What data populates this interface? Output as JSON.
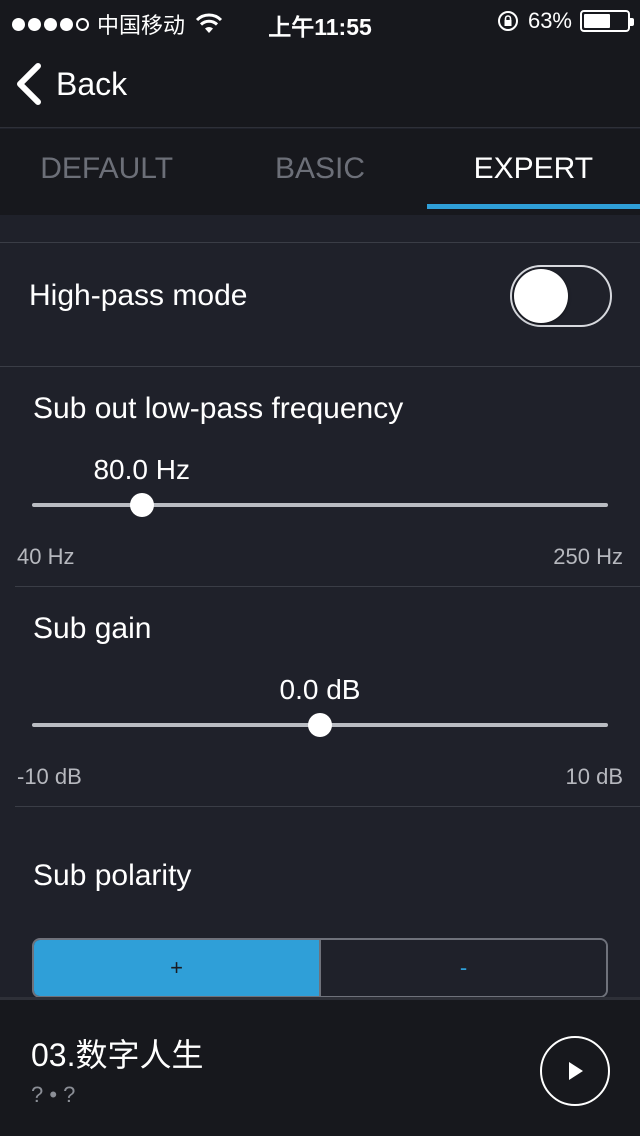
{
  "status_bar": {
    "carrier": "中国移动",
    "time": "上午11:55",
    "battery_percent_label": "63%",
    "battery_level": 0.63,
    "signal_dots_filled": 4,
    "signal_dots_total": 5
  },
  "nav": {
    "back_label": "Back"
  },
  "tabs": [
    {
      "label": "DEFAULT",
      "active": false
    },
    {
      "label": "BASIC",
      "active": false
    },
    {
      "label": "EXPERT",
      "active": true
    }
  ],
  "settings": {
    "high_pass": {
      "label": "High-pass mode",
      "enabled": false
    },
    "low_pass": {
      "label": "Sub out low-pass frequency",
      "value_label": "80.0 Hz",
      "value": 80.0,
      "min": 40,
      "max": 250,
      "min_label": "40 Hz",
      "max_label": "250 Hz"
    },
    "sub_gain": {
      "label": "Sub gain",
      "value_label": "0.0 dB",
      "value": 0.0,
      "min": -10,
      "max": 10,
      "min_label": "-10 dB",
      "max_label": "10 dB"
    },
    "polarity": {
      "label": "Sub polarity",
      "options": [
        "+",
        "-"
      ],
      "selected": "+"
    }
  },
  "now_playing": {
    "title": "03.数字人生",
    "subtitle": "? • ?"
  },
  "colors": {
    "accent": "#2f9fd8",
    "background": "#1f212a",
    "bar_background": "#17181d"
  }
}
